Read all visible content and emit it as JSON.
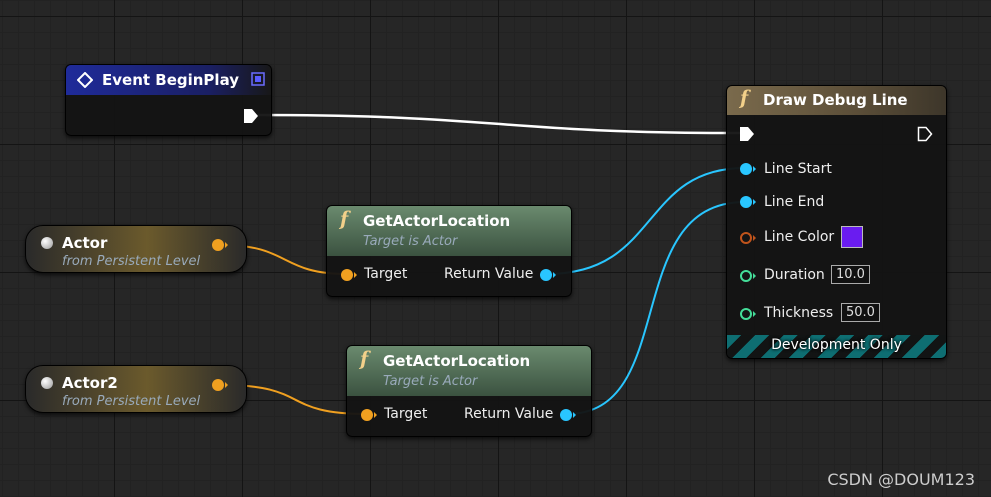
{
  "event_node": {
    "title": "Event BeginPlay"
  },
  "actor_nodes": [
    {
      "name": "Actor",
      "subtitle": "from Persistent Level"
    },
    {
      "name": "Actor2",
      "subtitle": "from Persistent Level"
    }
  ],
  "get_location_nodes": [
    {
      "title": "GetActorLocation",
      "subtitle": "Target is Actor",
      "input": "Target",
      "output": "Return Value"
    },
    {
      "title": "GetActorLocation",
      "subtitle": "Target is Actor",
      "input": "Target",
      "output": "Return Value"
    }
  ],
  "draw_debug_line": {
    "title": "Draw Debug Line",
    "line_start": "Line Start",
    "line_end": "Line End",
    "line_color": "Line Color",
    "line_color_value": "#6a1cf0",
    "duration": "Duration",
    "duration_value": "10.0",
    "thickness": "Thickness",
    "thickness_value": "50.0",
    "footer": "Development Only"
  },
  "function_symbol": "f",
  "watermark": "CSDN @DOUM123",
  "colors": {
    "exec_wire": "#ffffff",
    "object_pin": "#f0a020",
    "vector_pin": "#29c6ff",
    "float_pin": "#44dd99",
    "color_pin": "#c0541c",
    "event_header": "#1f2b9a",
    "function_header": "#5d7a62"
  }
}
